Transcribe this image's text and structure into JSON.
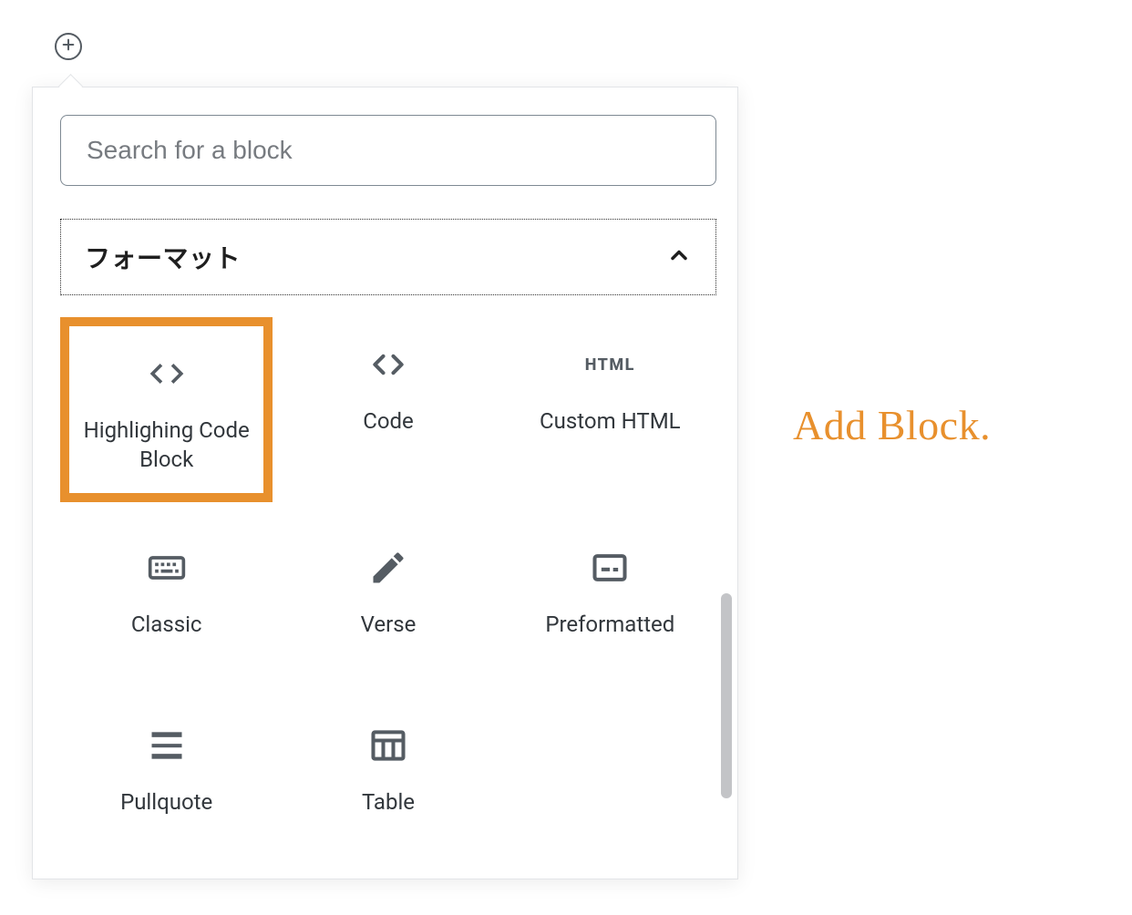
{
  "add_button": {
    "title": "Add block"
  },
  "search": {
    "placeholder": "Search for a block"
  },
  "category": {
    "title": "フォーマット"
  },
  "blocks": [
    {
      "label": "Highlighing Code Block",
      "icon": "code-bold",
      "highlighted": true
    },
    {
      "label": "Code",
      "icon": "code",
      "highlighted": false
    },
    {
      "label": "Custom HTML",
      "icon": "html",
      "highlighted": false
    },
    {
      "label": "Classic",
      "icon": "keyboard",
      "highlighted": false
    },
    {
      "label": "Verse",
      "icon": "pencil",
      "highlighted": false
    },
    {
      "label": "Preformatted",
      "icon": "preformatted",
      "highlighted": false
    },
    {
      "label": "Pullquote",
      "icon": "pullquote",
      "highlighted": false
    },
    {
      "label": "Table",
      "icon": "table",
      "highlighted": false
    }
  ],
  "caption": "Add Block.",
  "colors": {
    "accent": "#e8902d"
  }
}
